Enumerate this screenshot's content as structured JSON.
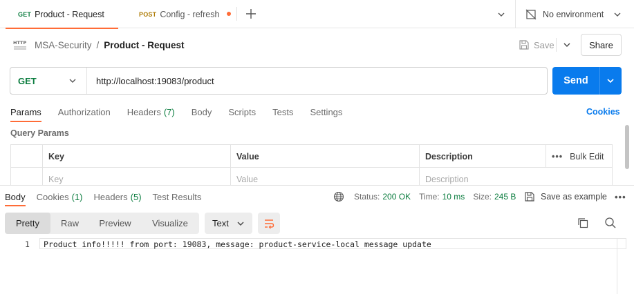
{
  "tabs": [
    {
      "method": "GET",
      "method_color": "#0a7c3e",
      "label": "Product - Request"
    },
    {
      "method": "POST",
      "method_color": "#ad7a03",
      "label": "Config - refresh",
      "unsaved_dot_color": "#ff6c37"
    }
  ],
  "environment": {
    "label": "No environment"
  },
  "breadcrumb": {
    "collection": "MSA-Security",
    "separator": "/",
    "request": "Product - Request"
  },
  "toolbar": {
    "save_label": "Save",
    "share_label": "Share"
  },
  "request": {
    "method": "GET",
    "url": "http://localhost:19083/product",
    "send_label": "Send"
  },
  "request_tabs": [
    {
      "label": "Params",
      "active": true
    },
    {
      "label": "Authorization"
    },
    {
      "label": "Headers",
      "count": "(7)"
    },
    {
      "label": "Body"
    },
    {
      "label": "Scripts"
    },
    {
      "label": "Tests"
    },
    {
      "label": "Settings"
    }
  ],
  "cookies_link": "Cookies",
  "query_params": {
    "title": "Query Params",
    "headers": {
      "key": "Key",
      "value": "Value",
      "description": "Description",
      "bulk_edit": "Bulk Edit"
    },
    "placeholders": {
      "key": "Key",
      "value": "Value",
      "description": "Description"
    }
  },
  "response_tabs": [
    {
      "label": "Body",
      "active": true
    },
    {
      "label": "Cookies",
      "count": "(1)"
    },
    {
      "label": "Headers",
      "count": "(5)"
    },
    {
      "label": "Test Results"
    }
  ],
  "response_meta": {
    "status_label": "Status:",
    "status_value": "200 OK",
    "time_label": "Time:",
    "time_value": "10 ms",
    "size_label": "Size:",
    "size_value": "245 B",
    "save_example": "Save as example"
  },
  "view_options": [
    "Pretty",
    "Raw",
    "Preview",
    "Visualize"
  ],
  "active_view": "Pretty",
  "format": "Text",
  "response_body": [
    {
      "line": "1",
      "text": "Product info!!!!! from port: 19083, message: product-service-local message update"
    }
  ],
  "colors": {
    "accent": "#ff6c37",
    "send_button": "#097bed",
    "success": "#0a7c3e"
  }
}
